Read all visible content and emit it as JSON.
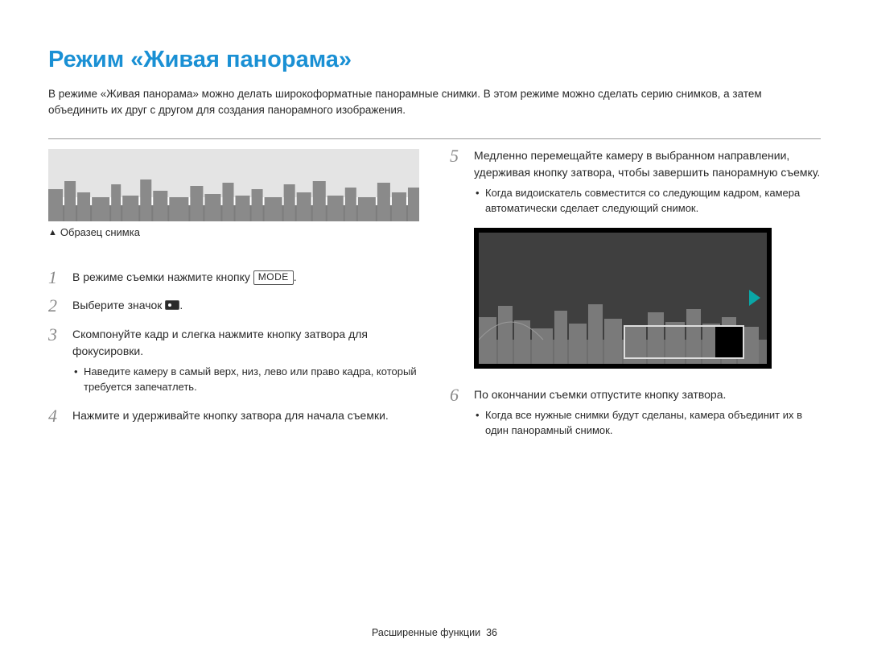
{
  "title": "Режим «Живая панорама»",
  "intro": "В режиме «Живая панорама» можно делать широкоформатные панорамные снимки. В этом режиме можно сделать серию снимков, а затем объединить их друг с другом для создания панорамного изображения.",
  "sample_caption": "Образец снимка",
  "steps": {
    "s1": {
      "num": "1",
      "text_a": "В режиме съемки нажмите кнопку ",
      "mode": "MODE",
      "text_b": "."
    },
    "s2": {
      "num": "2",
      "text_a": "Выберите значок ",
      "text_b": "."
    },
    "s3": {
      "num": "3",
      "text": "Скомпонуйте кадр и слегка нажмите кнопку затвора для фокусировки.",
      "sub": [
        "Наведите камеру в самый верх, низ, лево или право кадра, который требуется запечатлеть."
      ]
    },
    "s4": {
      "num": "4",
      "text": "Нажмите и удерживайте кнопку затвора для начала съемки."
    },
    "s5": {
      "num": "5",
      "text": "Медленно перемещайте камеру в выбранном направлении, удерживая кнопку затвора, чтобы завершить панорамную съемку.",
      "sub": [
        "Когда видоискатель совместится со следующим кадром, камера автоматически сделает следующий снимок."
      ]
    },
    "s6": {
      "num": "6",
      "text": "По окончании съемки отпустите кнопку затвора.",
      "sub": [
        "Когда все нужные снимки будут сделаны, камера объединит их в один панорамный снимок."
      ]
    }
  },
  "footer": {
    "section": "Расширенные функции",
    "page": "36"
  }
}
